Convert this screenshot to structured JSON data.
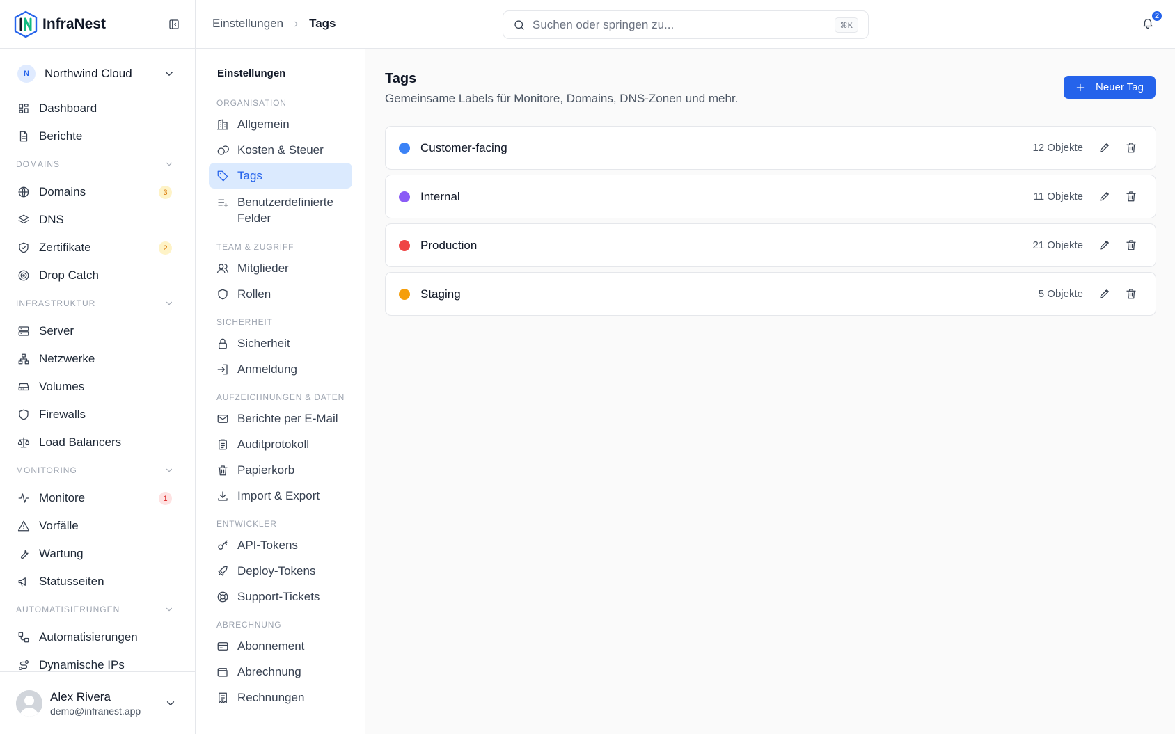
{
  "app": {
    "name": "InfraNest"
  },
  "org": {
    "initial": "N",
    "name": "Northwind Cloud"
  },
  "sidebar": {
    "top": [
      {
        "label": "Dashboard",
        "icon": "dashboard-icon"
      },
      {
        "label": "Berichte",
        "icon": "document-icon"
      }
    ],
    "sections": [
      {
        "title": "DOMAINS",
        "items": [
          {
            "label": "Domains",
            "icon": "globe-icon",
            "badge": "3",
            "badge_color": "amber"
          },
          {
            "label": "DNS",
            "icon": "layers-icon"
          },
          {
            "label": "Zertifikate",
            "icon": "shield-check-icon",
            "badge": "2",
            "badge_color": "amber"
          },
          {
            "label": "Drop Catch",
            "icon": "target-icon"
          }
        ]
      },
      {
        "title": "INFRASTRUKTUR",
        "items": [
          {
            "label": "Server",
            "icon": "server-icon"
          },
          {
            "label": "Netzwerke",
            "icon": "network-icon"
          },
          {
            "label": "Volumes",
            "icon": "hard-drive-icon"
          },
          {
            "label": "Firewalls",
            "icon": "shield-icon"
          },
          {
            "label": "Load Balancers",
            "icon": "scale-icon"
          }
        ]
      },
      {
        "title": "MONITORING",
        "items": [
          {
            "label": "Monitore",
            "icon": "activity-icon",
            "badge": "1",
            "badge_color": "red"
          },
          {
            "label": "Vorfälle",
            "icon": "warning-icon"
          },
          {
            "label": "Wartung",
            "icon": "wrench-icon"
          },
          {
            "label": "Statusseiten",
            "icon": "megaphone-icon"
          }
        ]
      },
      {
        "title": "AUTOMATISIERUNGEN",
        "items": [
          {
            "label": "Automatisierungen",
            "icon": "workflow-icon"
          },
          {
            "label": "Dynamische IPs",
            "icon": "route-icon"
          }
        ]
      }
    ]
  },
  "user": {
    "name": "Alex Rivera",
    "email": "demo@infranest.app"
  },
  "topbar": {
    "breadcrumb": [
      "Einstellungen",
      "Tags"
    ],
    "search_placeholder": "Suchen oder springen zu...",
    "search_shortcut": "⌘K",
    "notifications": "2"
  },
  "settings_nav": {
    "title": "Einstellungen",
    "groups": [
      {
        "title": "ORGANISATION",
        "items": [
          {
            "label": "Allgemein",
            "icon": "building-icon"
          },
          {
            "label": "Kosten & Steuer",
            "icon": "coins-icon"
          },
          {
            "label": "Tags",
            "icon": "tag-icon",
            "active": true
          },
          {
            "label": "Benutzerdefinierte Felder",
            "icon": "list-plus-icon",
            "multi": true
          }
        ]
      },
      {
        "title": "TEAM & ZUGRIFF",
        "items": [
          {
            "label": "Mitglieder",
            "icon": "users-icon"
          },
          {
            "label": "Rollen",
            "icon": "shield-icon"
          }
        ]
      },
      {
        "title": "SICHERHEIT",
        "items": [
          {
            "label": "Sicherheit",
            "icon": "lock-icon"
          },
          {
            "label": "Anmeldung",
            "icon": "login-icon"
          }
        ]
      },
      {
        "title": "AUFZEICHNUNGEN & DATEN",
        "items": [
          {
            "label": "Berichte per E-Mail",
            "icon": "mail-icon"
          },
          {
            "label": "Auditprotokoll",
            "icon": "clipboard-icon"
          },
          {
            "label": "Papierkorb",
            "icon": "trash-icon"
          },
          {
            "label": "Import & Export",
            "icon": "download-icon"
          }
        ]
      },
      {
        "title": "ENTWICKLER",
        "items": [
          {
            "label": "API-Tokens",
            "icon": "key-icon"
          },
          {
            "label": "Deploy-Tokens",
            "icon": "rocket-icon"
          },
          {
            "label": "Support-Tickets",
            "icon": "lifebuoy-icon"
          }
        ]
      },
      {
        "title": "ABRECHNUNG",
        "items": [
          {
            "label": "Abonnement",
            "icon": "credit-card-icon"
          },
          {
            "label": "Abrechnung",
            "icon": "wallet-icon"
          },
          {
            "label": "Rechnungen",
            "icon": "receipt-icon"
          }
        ]
      }
    ]
  },
  "main": {
    "title": "Tags",
    "subtitle": "Gemeinsame Labels für Monitore, Domains, DNS-Zonen und mehr.",
    "new_button": "Neuer Tag",
    "tags": [
      {
        "name": "Customer-facing",
        "count": "12 Objekte",
        "color": "#3b82f6"
      },
      {
        "name": "Internal",
        "count": "11 Objekte",
        "color": "#8b5cf6"
      },
      {
        "name": "Production",
        "count": "21 Objekte",
        "color": "#ef4444"
      },
      {
        "name": "Staging",
        "count": "5 Objekte",
        "color": "#f59e0b"
      }
    ]
  }
}
